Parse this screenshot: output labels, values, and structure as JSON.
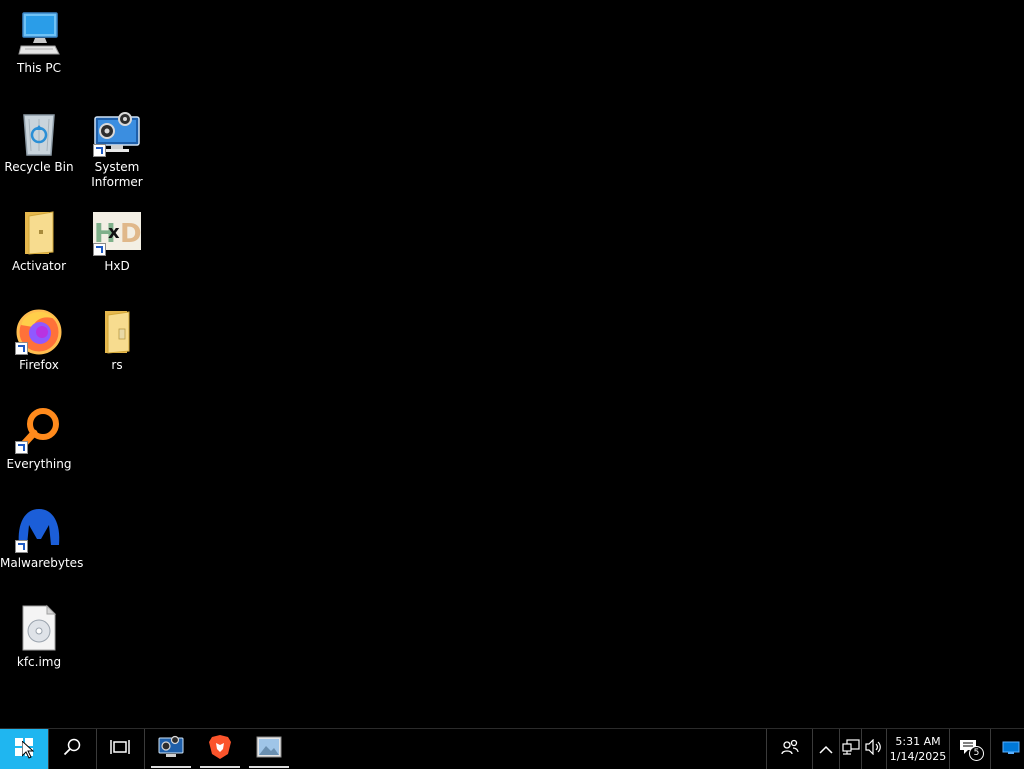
{
  "desktop": {
    "icons": [
      {
        "label": "This PC",
        "icon": "computer-icon"
      },
      {
        "label": "Recycle Bin",
        "icon": "recycle-bin-icon"
      },
      {
        "label": "System Informer",
        "icon": "system-informer-icon"
      },
      {
        "label": "Activator",
        "icon": "folder-icon"
      },
      {
        "label": "HxD",
        "icon": "hxd-icon"
      },
      {
        "label": "Firefox",
        "icon": "firefox-icon"
      },
      {
        "label": "rs",
        "icon": "folder-icon"
      },
      {
        "label": "Everything",
        "icon": "everything-icon"
      },
      {
        "label": "Malwarebytes",
        "icon": "malwarebytes-icon"
      },
      {
        "label": "kfc.img",
        "icon": "disc-image-icon"
      }
    ]
  },
  "taskbar": {
    "start_icon": "windows-icon",
    "search_icon": "search-icon",
    "task_view_icon": "task-view-icon",
    "pinned": [
      {
        "icon": "system-informer-icon",
        "running": true
      },
      {
        "icon": "brave-icon",
        "running": true
      },
      {
        "icon": "image-app-icon",
        "running": true
      }
    ],
    "tray": {
      "people_icon": "people-icon",
      "chevron_icon": "chevron-up-icon",
      "network_icon": "network-icon",
      "volume_icon": "volume-icon",
      "time": "5:31 AM",
      "date": "1/14/2025",
      "notification_icon": "notifications-icon",
      "notification_count": "5",
      "show_desktop_icon": "show-desktop-icon"
    }
  },
  "colors": {
    "start_highlight": "#1fb6f0",
    "accent_blue": "#0078d7"
  }
}
